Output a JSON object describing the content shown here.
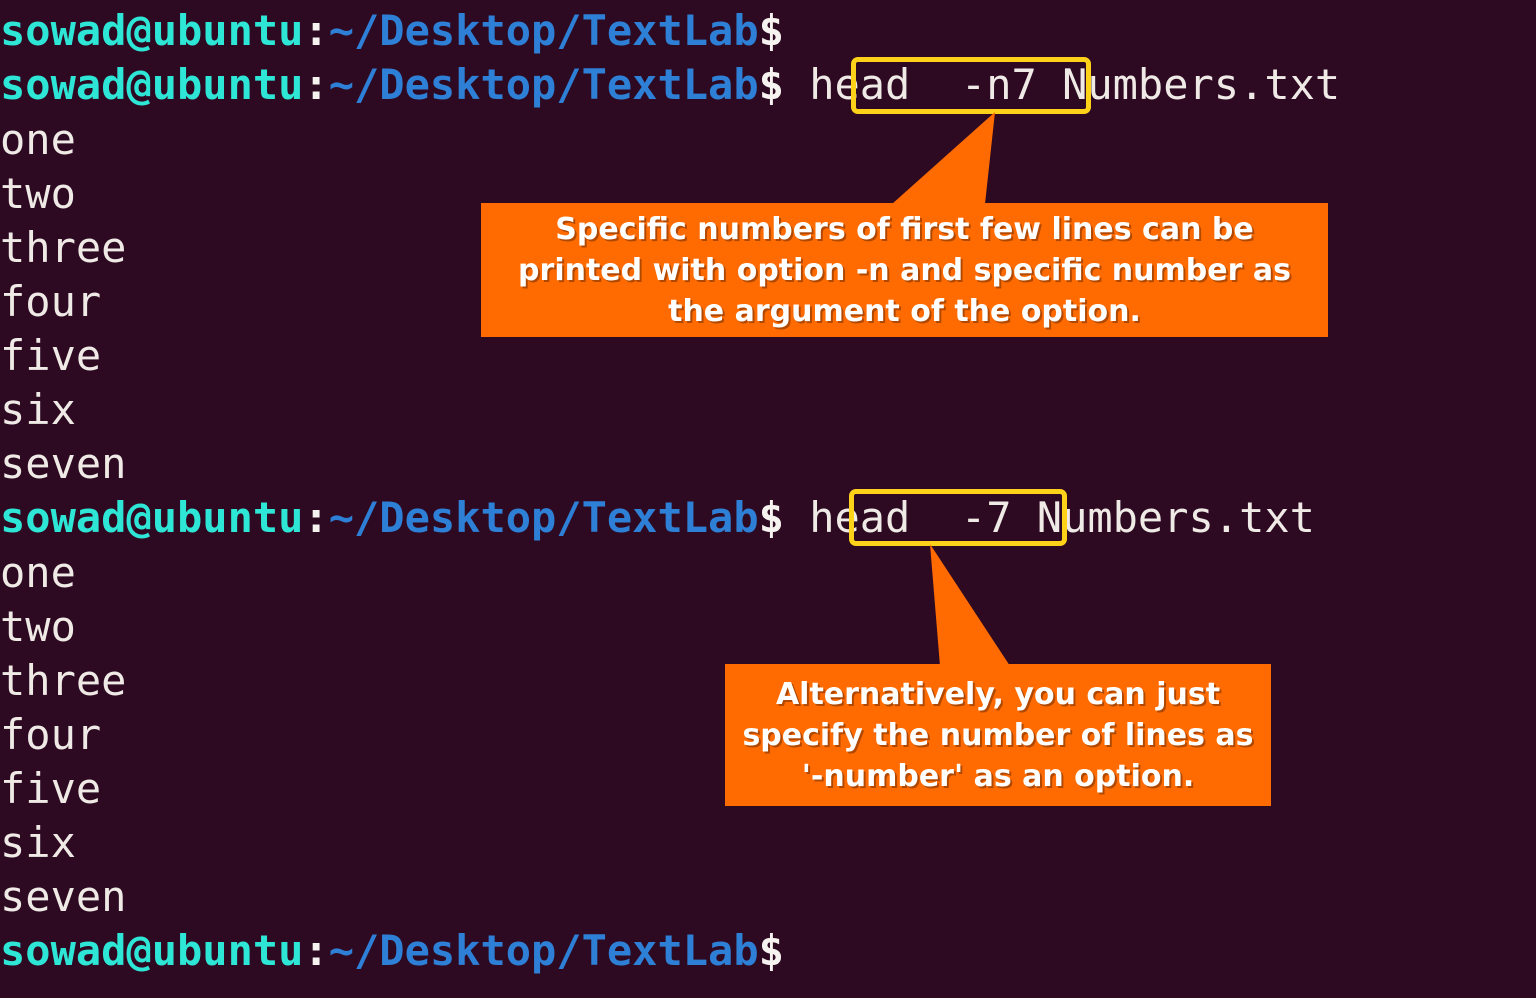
{
  "terminal": {
    "background_color": "#2D0A22",
    "user_host_color": "#2EE6D6",
    "path_color": "#2E7FD6",
    "output_color": "#EFEAE6",
    "highlight_border_color": "#FFD21A",
    "callout_color": "#FF6B00",
    "prompt": {
      "user_host": "sowad@ubuntu",
      "colon": ":",
      "path": "~/Desktop/TextLab",
      "dollar": "$"
    },
    "lines": [
      {
        "type": "prompt",
        "command": ""
      },
      {
        "type": "prompt",
        "command": "head -n7 Numbers.txt",
        "highlight": "head -n7"
      },
      {
        "type": "output",
        "text": "one"
      },
      {
        "type": "output",
        "text": "two"
      },
      {
        "type": "output",
        "text": "three"
      },
      {
        "type": "output",
        "text": "four"
      },
      {
        "type": "output",
        "text": "five"
      },
      {
        "type": "output",
        "text": "six"
      },
      {
        "type": "output",
        "text": "seven"
      },
      {
        "type": "prompt",
        "command": "head -7 Numbers.txt",
        "highlight": "head -7"
      },
      {
        "type": "output",
        "text": "one"
      },
      {
        "type": "output",
        "text": "two"
      },
      {
        "type": "output",
        "text": "three"
      },
      {
        "type": "output",
        "text": "four"
      },
      {
        "type": "output",
        "text": "five"
      },
      {
        "type": "output",
        "text": "six"
      },
      {
        "type": "output",
        "text": "seven"
      },
      {
        "type": "prompt",
        "command": ""
      }
    ],
    "commands": {
      "first_highlight": "head  -n7",
      "first_argument": " Numbers.txt",
      "second_highlight": "head  -7",
      "second_argument": " Numbers.txt"
    }
  },
  "annotations": [
    {
      "id": "callout-option-n",
      "lines": [
        "Specific numbers of first few lines can be",
        "printed with option -n and specific number as",
        "the argument of the option."
      ]
    },
    {
      "id": "callout-option-number",
      "lines": [
        "Alternatively, you can just",
        "specify the number of lines as",
        "'-number' as an option."
      ]
    }
  ]
}
